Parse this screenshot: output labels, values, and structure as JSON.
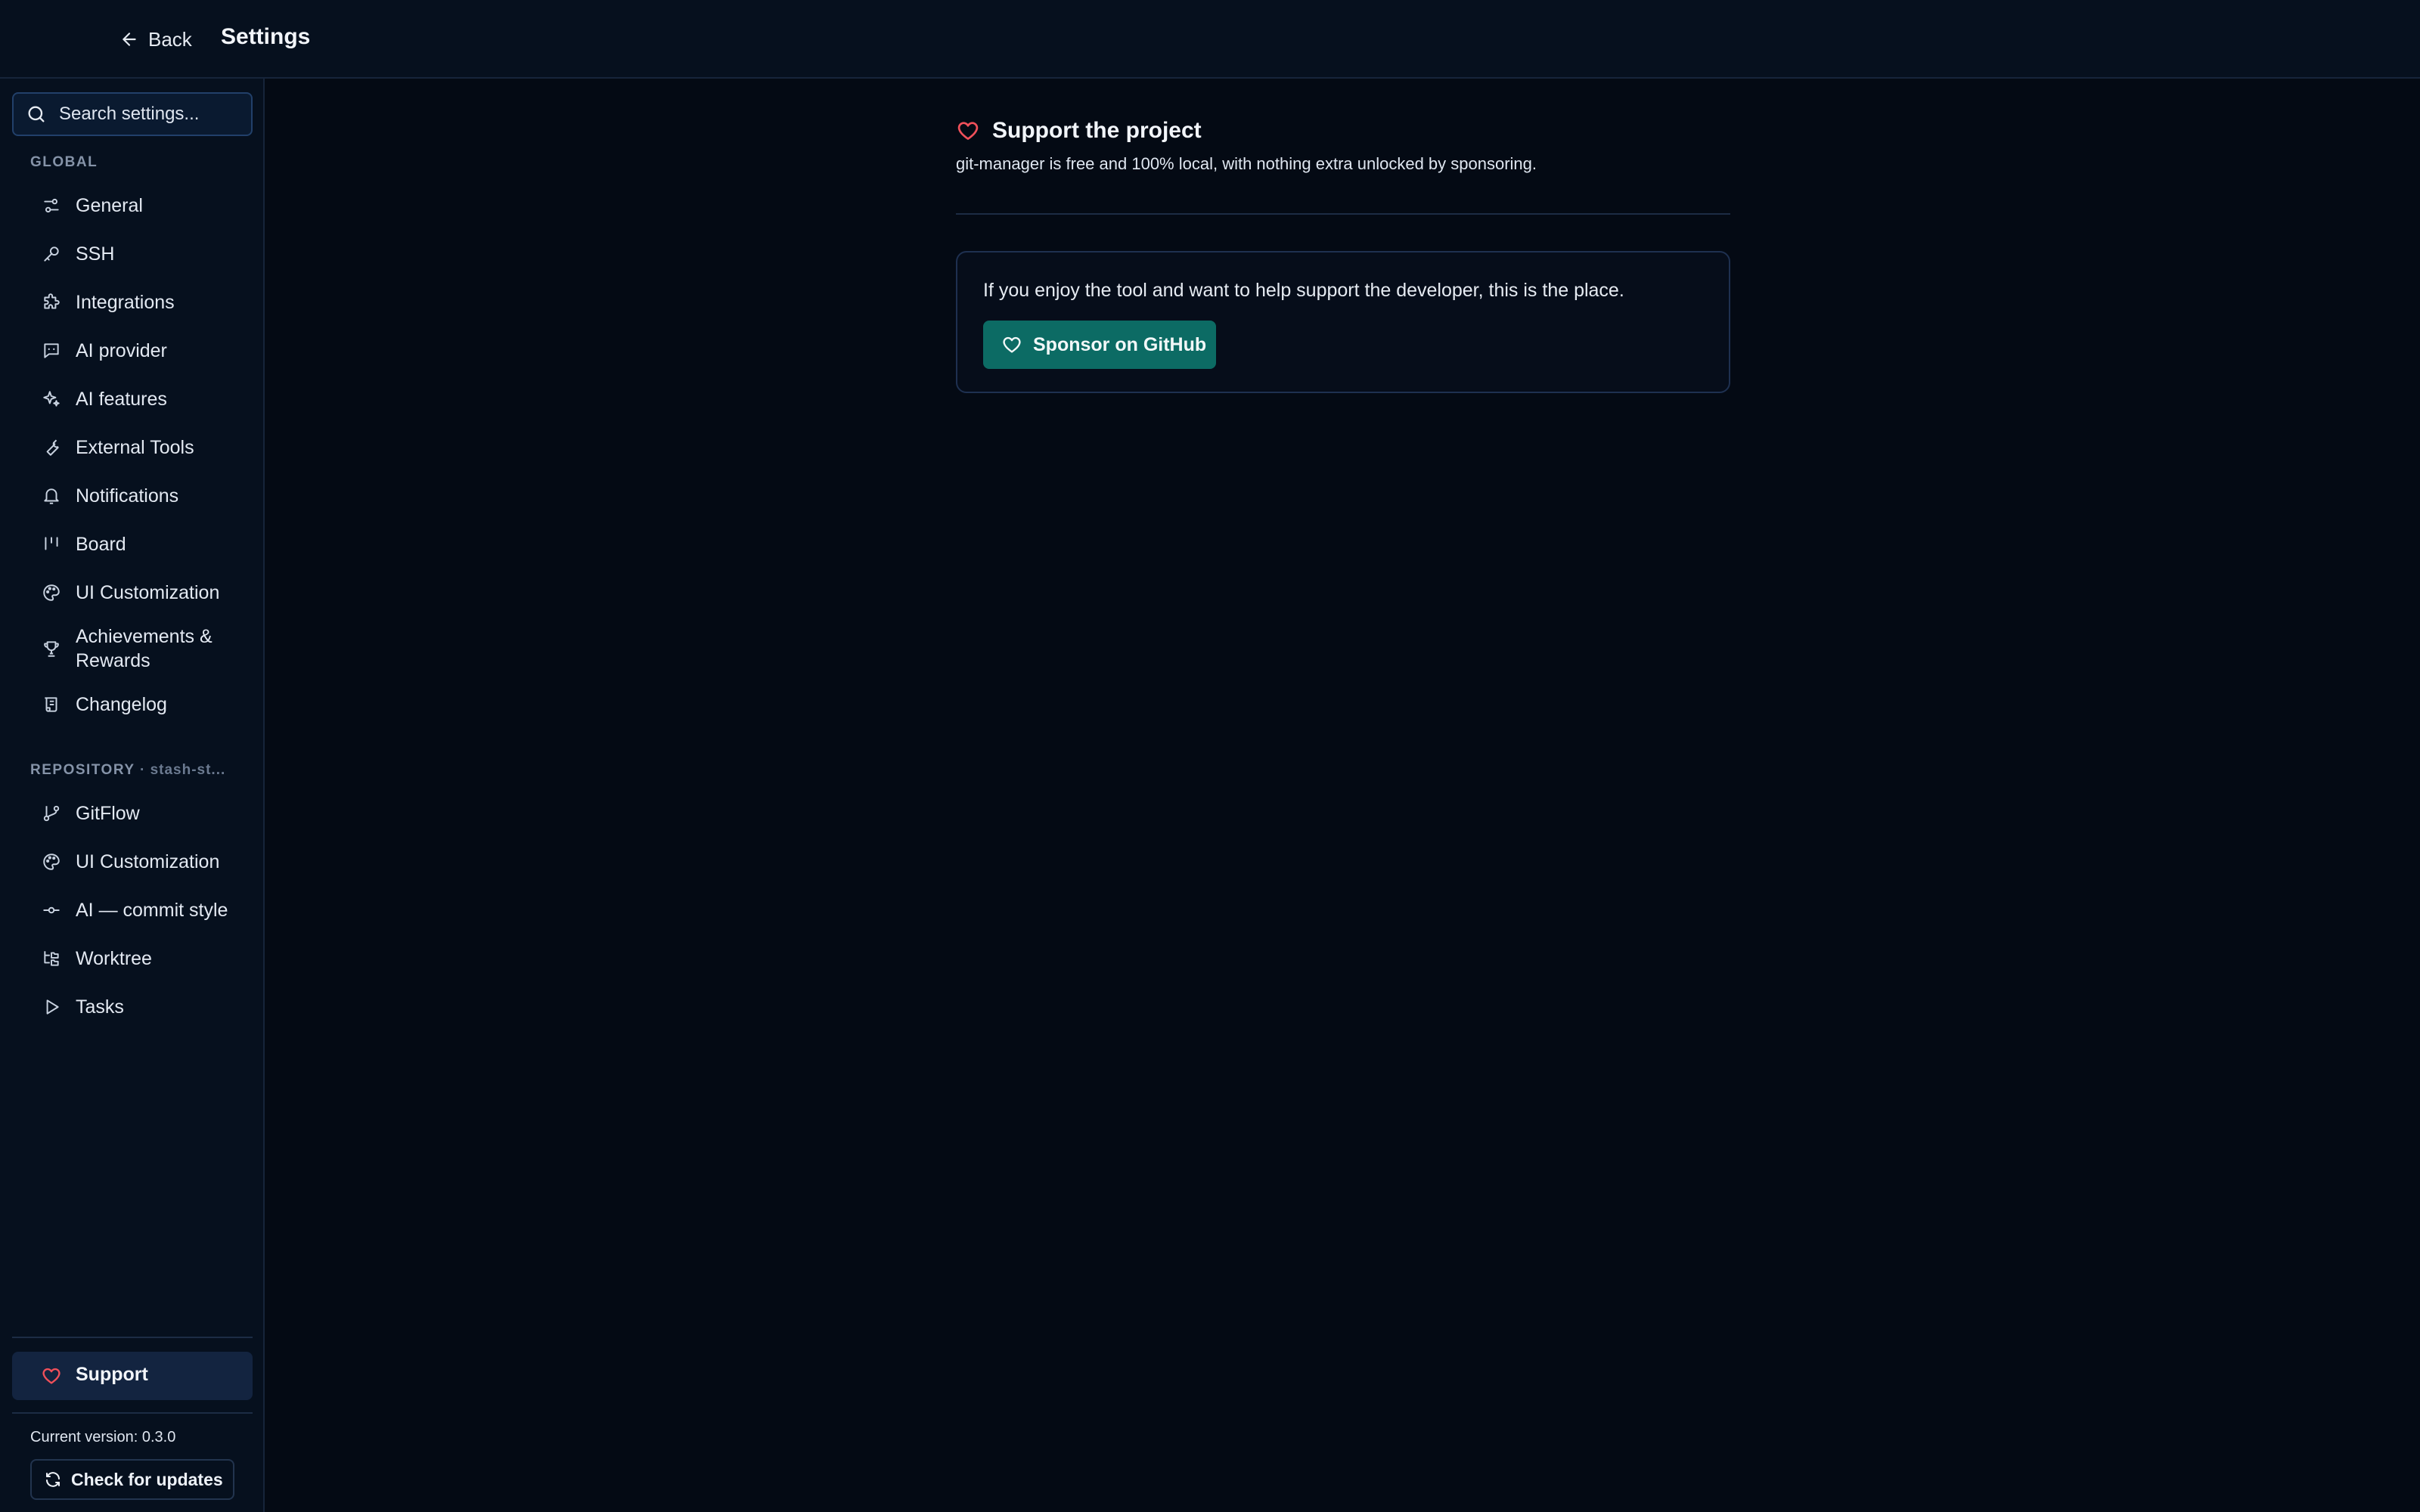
{
  "header": {
    "back_label": "Back",
    "title": "Settings"
  },
  "sidebar": {
    "search_placeholder": "Search settings...",
    "global_label": "GLOBAL",
    "global_items": [
      {
        "label": "General",
        "icon": "sliders-icon"
      },
      {
        "label": "SSH",
        "icon": "key-icon"
      },
      {
        "label": "Integrations",
        "icon": "puzzle-icon"
      },
      {
        "label": "AI provider",
        "icon": "message-bot-icon"
      },
      {
        "label": "AI features",
        "icon": "sparkles-icon"
      },
      {
        "label": "External Tools",
        "icon": "wrench-icon"
      },
      {
        "label": "Notifications",
        "icon": "bell-icon"
      },
      {
        "label": "Board",
        "icon": "kanban-icon"
      },
      {
        "label": "UI Customization",
        "icon": "palette-icon"
      },
      {
        "label": "Achievements & Rewards",
        "icon": "trophy-icon"
      },
      {
        "label": "Changelog",
        "icon": "scroll-icon"
      }
    ],
    "repository_label": "REPOSITORY",
    "repository_sub": "· stash-st...",
    "repository_items": [
      {
        "label": "GitFlow",
        "icon": "git-branch-icon"
      },
      {
        "label": "UI Customization",
        "icon": "palette-icon"
      },
      {
        "label": "AI — commit style",
        "icon": "git-commit-icon"
      },
      {
        "label": "Worktree",
        "icon": "folder-tree-icon"
      },
      {
        "label": "Tasks",
        "icon": "play-icon"
      }
    ],
    "support_label": "Support",
    "version_text": "Current version: 0.3.0",
    "check_updates_label": "Check for updates"
  },
  "main": {
    "title": "Support the project",
    "description": "git-manager is free and 100% local, with nothing extra unlocked by sponsoring.",
    "card_text": "If you enjoy the tool and want to help support the developer, this is the place.",
    "sponsor_label": "Sponsor on GitHub"
  },
  "colors": {
    "background": "#040a14",
    "sidebar": "#06101e",
    "accent_teal": "#0c6b64",
    "heart_red": "#f0505a",
    "active_item": "#132440"
  }
}
